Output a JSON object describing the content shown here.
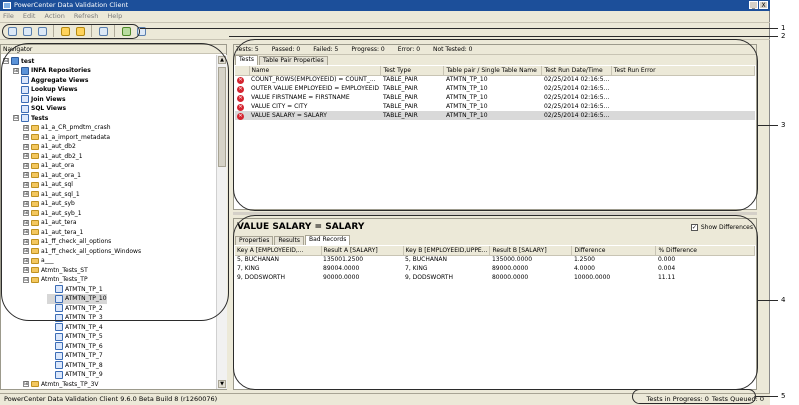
{
  "window": {
    "title": "PowerCenter Data Validation Client",
    "min": "_",
    "close": "X"
  },
  "menu": [
    "File",
    "Edit",
    "Action",
    "Refresh",
    "Help"
  ],
  "nav": {
    "header": "Navigator",
    "items": [
      {
        "label": "test",
        "toggle": "⊟",
        "icon": "root",
        "bold": true
      },
      {
        "label": "INFA Repositories",
        "toggle": "⊞",
        "icon": "repo",
        "bold": true
      },
      {
        "label": "Aggregate Views",
        "toggle": "",
        "icon": "view",
        "bold": true
      },
      {
        "label": "Lookup Views",
        "toggle": "",
        "icon": "view",
        "bold": true
      },
      {
        "label": "Join Views",
        "toggle": "",
        "icon": "view",
        "bold": true
      },
      {
        "label": "SQL Views",
        "toggle": "",
        "icon": "view",
        "bold": true
      },
      {
        "label": "Tests",
        "toggle": "⊟",
        "icon": "view",
        "bold": true
      },
      {
        "label": "a1_a_CR_pmdtm_crash",
        "toggle": "⊞",
        "icon": "folder"
      },
      {
        "label": "a1_a_import_metadata",
        "toggle": "⊞",
        "icon": "folder"
      },
      {
        "label": "a1_aut_db2",
        "toggle": "⊞",
        "icon": "folder"
      },
      {
        "label": "a1_aut_db2_1",
        "toggle": "⊞",
        "icon": "folder"
      },
      {
        "label": "a1_aut_ora",
        "toggle": "⊞",
        "icon": "folder"
      },
      {
        "label": "a1_aut_ora_1",
        "toggle": "⊞",
        "icon": "folder"
      },
      {
        "label": "a1_aut_sql",
        "toggle": "⊞",
        "icon": "folder"
      },
      {
        "label": "a1_aut_sql_1",
        "toggle": "⊞",
        "icon": "folder"
      },
      {
        "label": "a1_aut_syb",
        "toggle": "⊞",
        "icon": "folder"
      },
      {
        "label": "a1_aut_syb_1",
        "toggle": "⊞",
        "icon": "folder"
      },
      {
        "label": "a1_aut_tera",
        "toggle": "⊞",
        "icon": "folder"
      },
      {
        "label": "a1_aut_tera_1",
        "toggle": "⊞",
        "icon": "folder"
      },
      {
        "label": "a1_ff_check_all_options",
        "toggle": "⊞",
        "icon": "folder"
      },
      {
        "label": "a1_ff_check_all_options_Windows",
        "toggle": "⊞",
        "icon": "folder"
      },
      {
        "label": "a___",
        "toggle": "⊞",
        "icon": "folder"
      },
      {
        "label": "Atmtn_Tests_ST",
        "toggle": "⊞",
        "icon": "folder"
      },
      {
        "label": "Atmtn_Tests_TP",
        "toggle": "⊟",
        "icon": "folder"
      },
      {
        "label": "ATMTN_TP_1",
        "toggle": "",
        "icon": "test"
      },
      {
        "label": "ATMTN_TP_10",
        "toggle": "",
        "icon": "test",
        "selected": true
      },
      {
        "label": "ATMTN_TP_2",
        "toggle": "",
        "icon": "test"
      },
      {
        "label": "ATMTN_TP_3",
        "toggle": "",
        "icon": "test"
      },
      {
        "label": "ATMTN_TP_4",
        "toggle": "",
        "icon": "test"
      },
      {
        "label": "ATMTN_TP_5",
        "toggle": "",
        "icon": "test"
      },
      {
        "label": "ATMTN_TP_6",
        "toggle": "",
        "icon": "test"
      },
      {
        "label": "ATMTN_TP_7",
        "toggle": "",
        "icon": "test"
      },
      {
        "label": "ATMTN_TP_8",
        "toggle": "",
        "icon": "test"
      },
      {
        "label": "ATMTN_TP_9",
        "toggle": "",
        "icon": "test"
      },
      {
        "label": "Atmtn_Tests_TP_3V",
        "toggle": "⊞",
        "icon": "folder"
      }
    ]
  },
  "summary": {
    "tests": "Tests: 5",
    "passed": "Passed: 0",
    "failed": "Failed: 5",
    "progress": "Progress: 0",
    "error": "Error: 0",
    "not_tested": "Not Tested: 0"
  },
  "top_tabs": [
    "Tests",
    "Table Pair Properties"
  ],
  "tests_table": {
    "columns": [
      "",
      "Name",
      "Test Type",
      "Table pair / Single Table Name",
      "Test Run Date/Time",
      "Test Run Error"
    ],
    "rows": [
      [
        "COUNT_ROWS(EMPLOYEEID) = COUNT_...",
        "TABLE_PAIR",
        "ATMTN_TP_10",
        "02/25/2014 02:16:5...",
        ""
      ],
      [
        "OUTER VALUE EMPLOYEEID = EMPLOYEEID",
        "TABLE_PAIR",
        "ATMTN_TP_10",
        "02/25/2014 02:16:5...",
        ""
      ],
      [
        "VALUE FIRSTNAME = FIRSTNAME",
        "TABLE_PAIR",
        "ATMTN_TP_10",
        "02/25/2014 02:16:5...",
        ""
      ],
      [
        "VALUE CITY = CITY",
        "TABLE_PAIR",
        "ATMTN_TP_10",
        "02/25/2014 02:16:5...",
        ""
      ],
      [
        "VALUE SALARY = SALARY",
        "TABLE_PAIR",
        "ATMTN_TP_10",
        "02/25/2014 02:16:5...",
        ""
      ]
    ],
    "fail_mark": "✕"
  },
  "details": {
    "title": "VALUE SALARY = SALARY",
    "show_diff": "Show Differences",
    "show_diff_checked": "✓",
    "tabs": [
      "Properties",
      "Results",
      "Bad Records"
    ],
    "columns": [
      "Key A [EMPLOYEEID,...",
      "Result A [SALARY]",
      "Key B [EMPLOYEEID,UPPE...",
      "Result B [SALARY]",
      "Difference",
      "% Difference"
    ],
    "rows": [
      [
        "5, BUCHANAN",
        "135001.2500",
        "5, BUCHANAN",
        "135000.0000",
        "1.2500",
        "0.000"
      ],
      [
        "7, KING",
        "89004.0000",
        "7, KING",
        "89000.0000",
        "4.0000",
        "0.004"
      ],
      [
        "9, DODSWORTH",
        "90000.0000",
        "9, DODSWORTH",
        "80000.0000",
        "10000.0000",
        "11.11"
      ]
    ]
  },
  "status": {
    "left": "PowerCenter Data Validation Client 9.6.0 Beta Build 8 (r1260076)",
    "in_progress": "Tests in Progress: 0",
    "queued": "Tests Queued: 0"
  },
  "callouts": [
    "1",
    "2",
    "3",
    "4",
    "5"
  ],
  "colors": {
    "title_bar": "#1c4f9a",
    "fail": "#d4242f",
    "selected_row": "#d9d9d9"
  }
}
